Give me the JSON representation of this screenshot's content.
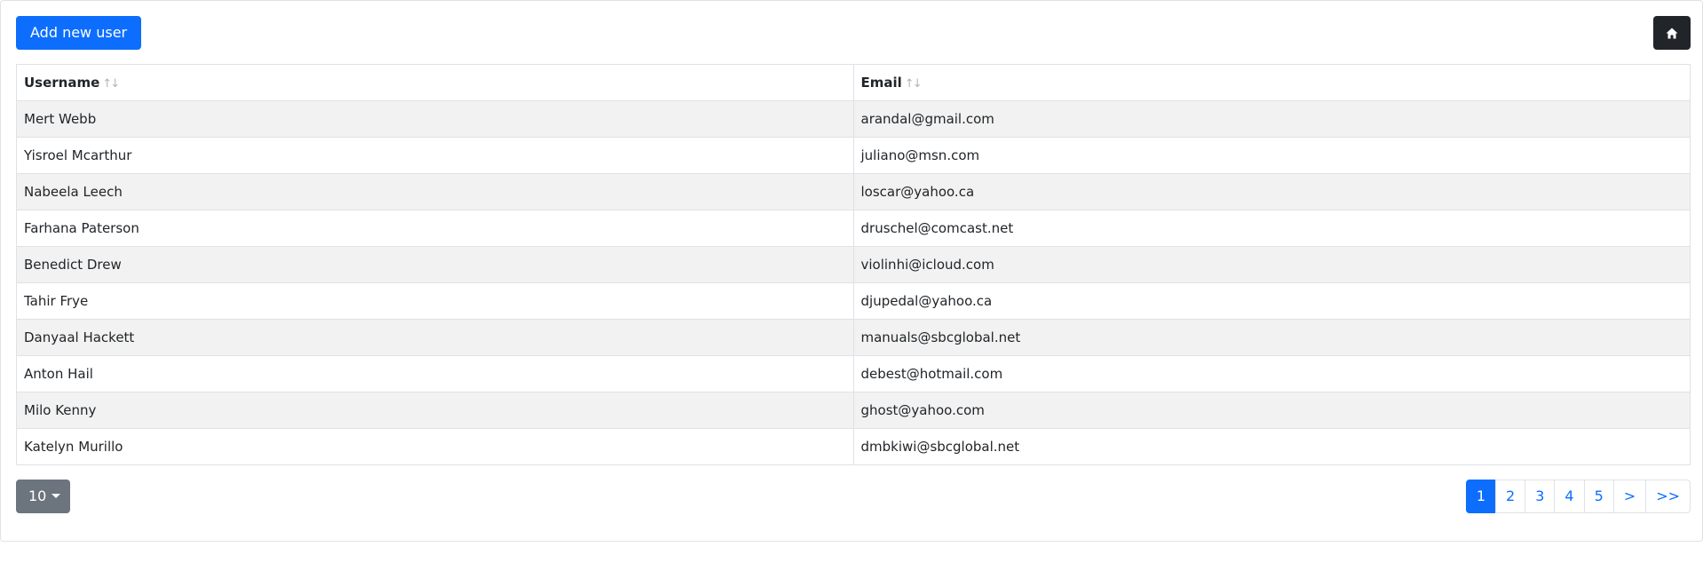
{
  "toolbar": {
    "add_user_label": "Add new user",
    "home_icon": "home-icon"
  },
  "table": {
    "columns": [
      "Username",
      "Email"
    ],
    "sort_glyph": "↑↓",
    "rows": [
      {
        "username": "Mert Webb",
        "email": "arandal@gmail.com"
      },
      {
        "username": "Yisroel Mcarthur",
        "email": "juliano@msn.com"
      },
      {
        "username": "Nabeela Leech",
        "email": "loscar@yahoo.ca"
      },
      {
        "username": "Farhana Paterson",
        "email": "druschel@comcast.net"
      },
      {
        "username": "Benedict Drew",
        "email": "violinhi@icloud.com"
      },
      {
        "username": "Tahir Frye",
        "email": "djupedal@yahoo.ca"
      },
      {
        "username": "Danyaal Hackett",
        "email": "manuals@sbcglobal.net"
      },
      {
        "username": "Anton Hail",
        "email": "debest@hotmail.com"
      },
      {
        "username": "Milo Kenny",
        "email": "ghost@yahoo.com"
      },
      {
        "username": "Katelyn Murillo",
        "email": "dmbkiwi@sbcglobal.net"
      }
    ]
  },
  "footer": {
    "page_size": "10",
    "pages": [
      "1",
      "2",
      "3",
      "4",
      "5",
      ">",
      ">>"
    ],
    "active_page": "1"
  },
  "colors": {
    "primary": "#0d6efd",
    "dark": "#212529",
    "secondary": "#6c757d",
    "stripe": "#f2f2f2"
  }
}
